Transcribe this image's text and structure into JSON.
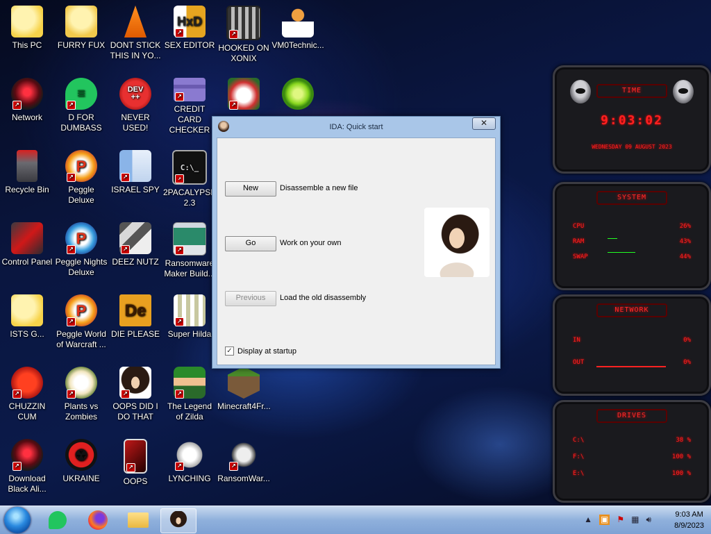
{
  "desktop_icons": [
    {
      "label": "This PC"
    },
    {
      "label": "FURRY FUX"
    },
    {
      "label": "DONT STICK THIS IN YO..."
    },
    {
      "label": "SEX EDITOR"
    },
    {
      "label": "HOOKED ON XONIX"
    },
    {
      "label": "VM0Technic..."
    },
    {
      "label": "Network"
    },
    {
      "label": "D FOR DUMBASS"
    },
    {
      "label": "NEVER USED!"
    },
    {
      "label": "CREDIT CARD CHECKER"
    },
    {
      "label": "Recycle Bin"
    },
    {
      "label": "Peggle Deluxe"
    },
    {
      "label": "ISRAEL SPY"
    },
    {
      "label": "2PACALYPSE 2.3"
    },
    {
      "label": "Control Panel"
    },
    {
      "label": "Peggle Nights Deluxe"
    },
    {
      "label": "DEEZ NUTZ"
    },
    {
      "label": "Ransomware Maker Build..."
    },
    {
      "label": "ISTS G..."
    },
    {
      "label": "Peggle World of Warcraft ..."
    },
    {
      "label": "DIE PLEASE"
    },
    {
      "label": "Super Hilda"
    },
    {
      "label": "CHUZZIN CUM"
    },
    {
      "label": "Plants vs Zombies"
    },
    {
      "label": "OOPS DID I DO THAT"
    },
    {
      "label": "The Legend of Zilda"
    },
    {
      "label": "Minecraft4Fr..."
    },
    {
      "label": "Download Black Ali..."
    },
    {
      "label": "UKRAINE"
    },
    {
      "label": "OOPS"
    },
    {
      "label": "LYNCHING"
    },
    {
      "label": "RansomWar..."
    }
  ],
  "icon_glyphs": {
    "dev": "DEV\n++",
    "de": "De"
  },
  "dialog": {
    "title": "IDA: Quick start",
    "close_label": "✕",
    "new_button": "New",
    "new_desc": "Disassemble a new file",
    "go_button": "Go",
    "go_desc": "Work on your own",
    "previous_button": "Previous",
    "previous_desc": "Load the old disassembly",
    "startup_checkbox": "Display at startup",
    "startup_checked": true
  },
  "widgets": {
    "time": {
      "header": "TIME",
      "clock": "9:03:02",
      "date": "WEDNESDAY 09 AUGUST 2023"
    },
    "system": {
      "header": "SYSTEM",
      "cpu_label": "CPU",
      "cpu_value": "26%",
      "ram_label": "RAM",
      "ram_value": "43%",
      "swap_label": "SWAP",
      "swap_value": "44%"
    },
    "network": {
      "header": "NETWORK",
      "in_label": "IN",
      "in_value": "0%",
      "out_label": "OUT",
      "out_value": "0%"
    },
    "drives": {
      "header": "DRIVES",
      "c_label": "C:\\",
      "c_value": "38 %",
      "f_label": "F:\\",
      "f_value": "100 %",
      "e_label": "E:\\",
      "e_value": "100 %"
    }
  },
  "taskbar": {
    "time": "9:03 AM",
    "date": "8/9/2023"
  },
  "colors": {
    "widget_red": "#ff2020",
    "taskbar": "#8fb0dc",
    "dialog_frame": "#a9c6e8"
  }
}
